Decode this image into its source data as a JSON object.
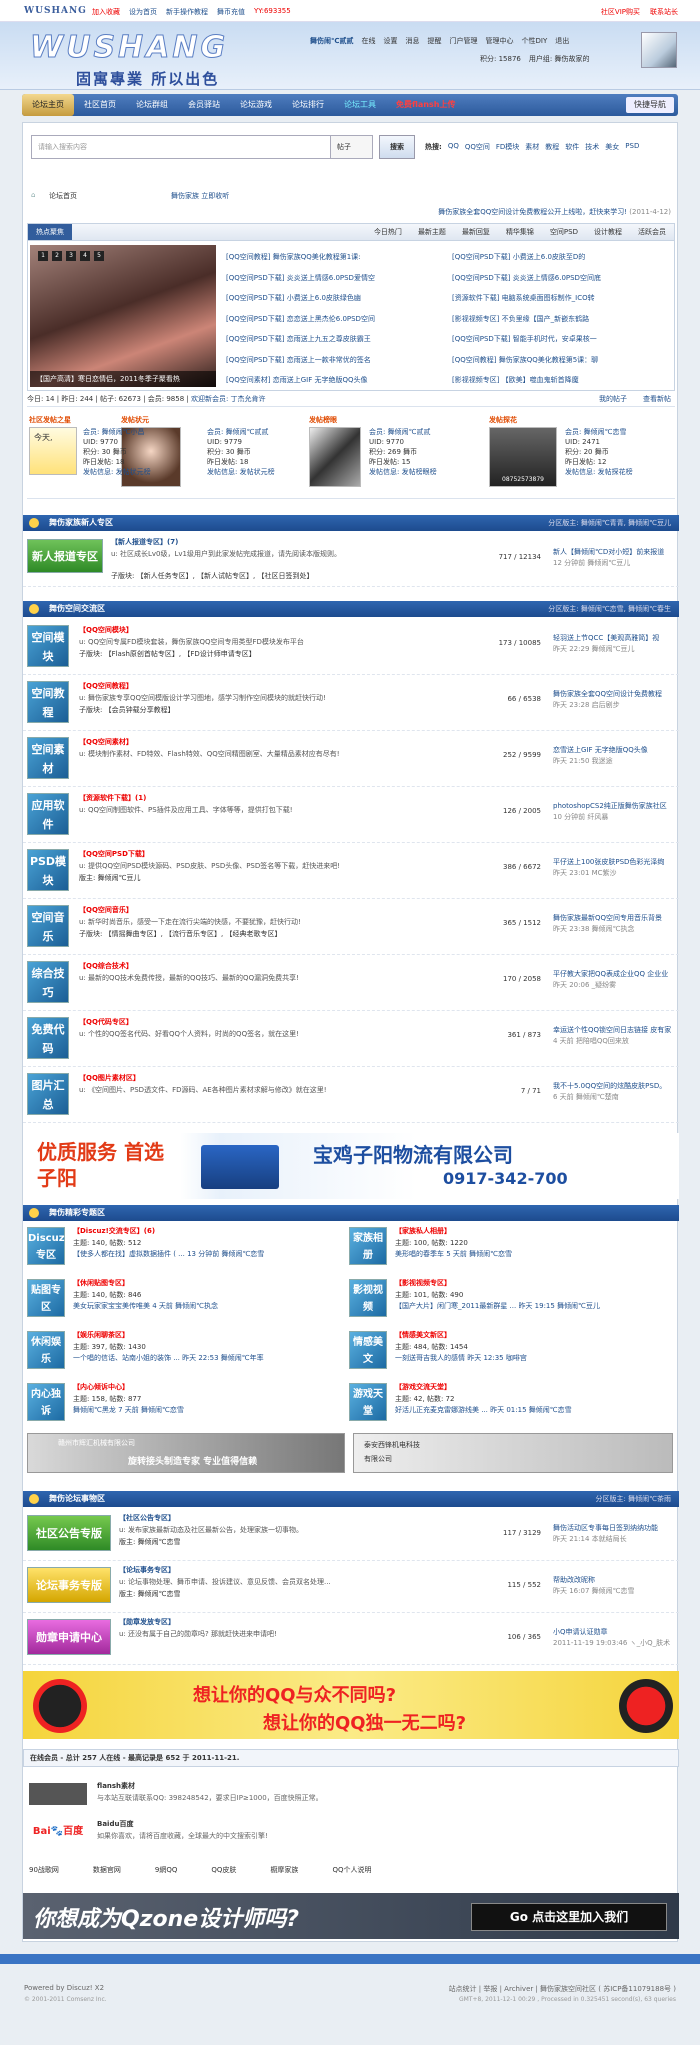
{
  "topbar": {
    "logo": "WUSHANG",
    "links": [
      "加入收藏",
      "设为首页",
      "新手操作教程",
      "舞币充值",
      "YY:693355"
    ],
    "right": [
      "社区VIP购买",
      "联系站长"
    ]
  },
  "header": {
    "logo": "WUSHANG",
    "slogan": "固寓專業 所以出色",
    "user": [
      "舞伤闹℃贰贰",
      "在线",
      "设置",
      "消息",
      "提醒",
      "门户管理",
      "管理中心",
      "个性DIY",
      "退出"
    ],
    "user2": [
      "积分: 15876",
      "用户组: 舞伤故家的"
    ]
  },
  "nav": {
    "items": [
      "论坛主页",
      "社区首页",
      "论坛群组",
      "会员驿站",
      "论坛游戏",
      "论坛排行",
      "论坛工具",
      "免费flansh上传"
    ],
    "quick": "快捷导航"
  },
  "search": {
    "placeholder": "请输入搜索内容",
    "select": "帖子",
    "button": "搜索",
    "hot_label": "热搜:",
    "hot": [
      "QQ",
      "QQ空间",
      "FD模块",
      "素材",
      "教程",
      "软件",
      "技术",
      "美女",
      "PSD"
    ]
  },
  "crumb": {
    "board": "论坛首页",
    "fav": "舞伤家族",
    "fav2": "立即收听"
  },
  "notice": {
    "text": "舞伤家族全套QQ空间设计免费教程公开上线啦，赶快来学习!",
    "date": "(2011-4-12)"
  },
  "tabs": {
    "items": [
      "热点聚焦",
      "今日热门",
      "最新主题",
      "最新回复",
      "精华集锦",
      "空间PSD",
      "设计教程",
      "活跃会员"
    ]
  },
  "feature": {
    "dots": [
      "1",
      "2",
      "3",
      "4",
      "5"
    ],
    "caption": "【国产高清】寒日恋情侣，2011冬季子聚看热",
    "col1": [
      "[QQ空间教程] 舞伤家族QQ美化教程第1课:",
      "[QQ空间PSD下载] 炎炎送上情感6.0PSD爱情空",
      "[QQ空间PSD下载] 小费送上6.0皮肤绿色幽",
      "[QQ空间PSD下载] 恋恋送上黑杰伦6.0PSD空间",
      "[QQ空间PSD下载] 恋雨送上九五之尊皮肤霸王",
      "[QQ空间PSD下载] 恋雨送上一款非常优的签名",
      "[QQ空间素材] 恋雨送上GIF 无字绝版QQ头像"
    ],
    "col2": [
      "[QQ空间PSD下载] 小费送上6.0皮肤至D的",
      "[QQ空间PSD下载] 炎炎送上情感6.0PSD空间底",
      "[资源软件下载] 电脑系统桌面图标制作_ICO转",
      "[影视视频专区] 不负里缘【国产_新嵌东鹤路",
      "[QQ空间PSD下载] 智能手机时代，安卓果核一",
      "[QQ空间教程] 舞伤家族QQ美化教程第5课：聊",
      "[影视视频专区] 【欧美】噬血鬼斩首降魔"
    ]
  },
  "stats": {
    "today": "今日: 14",
    "yesterday": "昨日: 244",
    "threads": "帖子: 62673",
    "members": "会员: 9858",
    "newest": "欢迎新会员: 丁杰允肯许",
    "mine": "我的帖子",
    "view": "查看新帖"
  },
  "stars": [
    {
      "title": "社区发帖之星",
      "name": "会员: 舞倾闹℃小昌",
      "uid": "UID: 9770",
      "credit": "积分: 30 舞币",
      "yday": "昨日发帖: 18",
      "link": "发帖信息: 发帖状元榜",
      "pic": "今天,"
    },
    {
      "title": "发帖状元",
      "name": "会员: 舞倾闹℃贰贰",
      "uid": "UID: 9779",
      "credit": "积分: 30 舞币",
      "yday": "昨日发帖: 18",
      "link": "发帖信息: 发帖状元榜",
      "pic": ""
    },
    {
      "title": "发帖榜眼",
      "name": "会员: 舞倾闹℃贰贰",
      "uid": "UID: 9770",
      "credit": "积分: 269 舞币",
      "yday": "昨日发帖: 15",
      "link": "发帖信息: 发帖榜眼榜",
      "pic": ""
    },
    {
      "title": "发帖探花",
      "name": "会员: 舞倾闹℃恋雪",
      "uid": "UID: 2471",
      "credit": "积分: 20 舞币",
      "yday": "昨日发帖: 12",
      "link": "发帖信息: 发帖探花榜",
      "pic": "08752573879"
    }
  ],
  "s1": {
    "title": "舞伤家族新人专区",
    "mod": "分区版主: 舞倾闹℃青青, 舞倾闹℃豆儿",
    "rows": [
      {
        "icon": "新人报道专区",
        "title": "【新人报道专区】(7)",
        "desc": "u: 社区成长Lv0级，Lv1级用户到此家发帖完成报道，请先阅读本版规则。",
        "sub": "子版块: 【新人任务专区】, 【新人试帖专区】, 【社区日签到处】",
        "num": "717 / 12134",
        "last": "新人【舞倾闹℃D对小短】前来报道",
        "last2": "12 分钟前 舞倾闹℃豆儿"
      }
    ]
  },
  "s2": {
    "title": "舞伤空间交流区",
    "mod": "分区版主: 舞倾闹℃恋雪, 舞倾闹℃春生",
    "rows": [
      {
        "icon": "空间模块",
        "title": "【QQ空间模块】",
        "desc": "u: QQ空间专属FD模块套装，舞伤家族QQ空间专用类型FD模块发布平台",
        "sub": "子版块: 【Flash原创首帖专区】, 【FD设计师申请专区】",
        "num": "173 / 10085",
        "last": "轻羽送上节QCC【美观高雅简】视",
        "last2": "昨天 22:29 舞倾闹℃豆儿"
      },
      {
        "icon": "空间教程",
        "title": "【QQ空间教程】",
        "desc": "u: 舞伤家族专享QQ空间模版设计学习图地，感学习制作空间模块的就赶快行动!",
        "sub": "子版块: 【会员钟载分享教程】",
        "num": "66 / 6538",
        "last": "舞伤家族全套QQ空间设计免费教程",
        "last2": "昨天 23:28 启后剧步"
      },
      {
        "icon": "空间素材",
        "title": "【QQ空间素材】",
        "desc": "u: 模块制作素材、FD特效、Flash特效、QQ空间精图剧室、大量精品素材应有尽有!",
        "sub": "",
        "num": "252 / 9599",
        "last": "恋雪送上GIF 无字绝版QQ头像",
        "last2": "昨天 21:50 我迷途"
      },
      {
        "icon": "应用软件",
        "title": "【资源软件下载】(1)",
        "desc": "u: QQ空间制图软件、PS插件及应用工具、字体等等，提供打包下载!",
        "sub": "",
        "num": "126 / 2005",
        "last": "photoshopCS2纯正版舞伤家族社区",
        "last2": "10 分钟前 纤风暴"
      },
      {
        "icon": "PSD模块",
        "title": "【QQ空间PSD下载】",
        "desc": "u: 提供QQ空间PSD模块源码、PSD皮肤、PSD头像、PSD签名等下载，赶快进来吧!",
        "sub": "版主: 舞倾闹℃豆儿",
        "num": "386 / 6672",
        "last": "平仔送上100张皮肤PSD色彩光泽绚",
        "last2": "昨天 23:01 MC紫沙"
      },
      {
        "icon": "空间音乐",
        "title": "【QQ空间音乐】",
        "desc": "u: 新华时尚音乐，感受一下走在流行尖端的快感，不要犹豫，赶快行动!",
        "sub": "子版块: 【情摇舞曲专区】, 【流行音乐专区】, 【经典老歌专区】",
        "num": "365 / 1512",
        "last": "舞伤家族最新QQ空间专用音乐背景",
        "last2": "昨天 23:38 舞倾闹℃执念"
      },
      {
        "icon": "综合技巧",
        "title": "【QQ综合技术】",
        "desc": "u: 最新的QQ技术免费传授，最新的QQ技巧、最新的QQ漏洞免费共享!",
        "sub": "",
        "num": "170 / 2058",
        "last": "平仔教大家把QQ表成企业QQ 企业业",
        "last2": "昨天 20:06 _疑纷雾"
      },
      {
        "icon": "免费代码",
        "title": "【QQ代码专区】",
        "desc": "u: 个性的QQ签名代码、好看QQ个人资料，时尚的QQ签名，就在这里!",
        "sub": "",
        "num": "361 / 873",
        "last": "幸运送个性QQ锁空间日志链接 皮有家",
        "last2": "4 天前 把陪唱QQ回来放"
      },
      {
        "icon": "图片汇总",
        "title": "【QQ图片素材区】",
        "desc": "u: 《空间图片、PSD透文件、FD源码、AE各种图片素材求解与修改》就在这里!",
        "sub": "",
        "num": "7 / 71",
        "last": "我不十5.0QQ空间的炫酷皮肤PSD。",
        "last2": "6 天前 舞倾闹℃楚南"
      }
    ]
  },
  "ad1": {
    "left": "优质服务 首选子阳",
    "right": "宝鸡子阳物流有限公司",
    "phone": "0917-342-700"
  },
  "s3": {
    "title": "舞伤精彩专题区",
    "items": [
      {
        "icon": "Discuz专区",
        "title": "【Discuz!交流专区】(6)",
        "l1": "主题: 140, 帖数: 512",
        "l2": "【使多人都在找】虚拟数据插件 ( ... 13 分钟前 舞倾闹℃恋雪"
      },
      {
        "icon": "家族相册",
        "title": "【家族私人相册】",
        "l1": "主题: 100, 帖数: 1220",
        "l2": "美形唱的春季车 5 天前 舞倾闹℃恋雪"
      },
      {
        "icon": "贴图专区",
        "title": "【休闲贴图专区】",
        "l1": "主题: 140, 帖数: 846",
        "l2": "美女玩家家宝宝美传唯美 4 天前 舞倾闹℃执念"
      },
      {
        "icon": "影视视频",
        "title": "【影视视频专区】",
        "l1": "主题: 101, 帖数: 490",
        "l2": "【国产大片】闲门寒_2011最新群星 ... 昨天 19:15 舞倾闹℃豆儿"
      },
      {
        "icon": "休闲娱乐",
        "title": "【娱乐闲聊茶区】",
        "l1": "主题: 397, 帖数: 1430",
        "l2": "一个唱的信话、站南小姐的装饰 ... 昨天 22:53 舞倾闹℃年率"
      },
      {
        "icon": "情感美文",
        "title": "【情感美文新区】",
        "l1": "主题: 484, 帖数: 1454",
        "l2": "一刻送哥吉我人的感情 昨天 12:35 咖啡宫"
      },
      {
        "icon": "内心独诉",
        "title": "【内心倾诉中心】",
        "l1": "主题: 158, 帖数: 877",
        "l2": "舞倾闹℃黑龙 7 天前 舞倾闹℃恋雪"
      },
      {
        "icon": "游戏天堂",
        "title": "【游戏交流天堂】",
        "l1": "主题: 42, 帖数: 72",
        "l2": "好活儿正充麦克雷娜游线美 ... 昨天 01:15 舞倾闹℃恋雪"
      }
    ]
  },
  "ad2": {
    "left1": "赣州市辉汇机械有限公司",
    "left2": "旋转接头制造专家 专业值得信赖",
    "right1": "泰安西锋机电科技",
    "right2": "有限公司"
  },
  "s4": {
    "title": "舞伤论坛事物区",
    "mod": "分区版主: 舞倾闹℃茶雨",
    "rows": [
      {
        "icon": "社区公告专版",
        "title": "【社区公告专区】",
        "desc": "u: 发布家族最新动态及社区最新公告，处理家族一切事物。",
        "sub": "版主: 舞倾闹℃恋雪",
        "num": "117 / 3129",
        "last": "舞伤活动区专事每日签到纳纳功能",
        "last2": "昨天 21:14 本就结局长"
      },
      {
        "icon": "论坛事务专版",
        "title": "【论坛事务专区】",
        "desc": "u: 论坛事物处理、舞币申请、投诉建议、意见反馈、会员双名处理...",
        "sub": "版主: 舞倾闹℃恋雪",
        "num": "115 / 552",
        "last": "帮助改改昵称",
        "last2": "昨天 16:07 舞倾闹℃恋雪"
      },
      {
        "icon": "勋章申请中心",
        "title": "【勋章发放专区】",
        "desc": "u: 还没有属于自己的勋章吗? 那就赶快进来申请吧!",
        "sub": "",
        "num": "106 / 365",
        "last": "小Q申请认证勋章",
        "last2": "2011-11-19 19:03:46 ヽ_小Q_肤术"
      }
    ]
  },
  "ad3": {
    "line1": "想让你的QQ与众不同吗?",
    "line2": "想让你的QQ独一无二吗?"
  },
  "online": {
    "head": "在线会员 - 总计 257 人在线 - 最高记录是 652 于 2011-11-21.",
    "links": [
      {
        "name": "flansh素材",
        "desc": "与本站互联请联系QQ: 398248542，要求日IP≥1000，百度快照正常。"
      },
      {
        "name": "Baidu百度",
        "desc": "如果你喜欢，请将百度收藏，全球最大的中文搜索引擎!"
      }
    ],
    "small": [
      "90战歌网",
      "数据官网",
      "9網QQ",
      "QQ皮肤",
      "橱摩家族",
      "QQ个人说明"
    ]
  },
  "ad4": {
    "text": "你想成为Qzone设计师吗?",
    "btn": "Go 点击这里加入我们"
  },
  "footer": {
    "powered": "Powered by Discuz! X2",
    "copy": "© 2001-2011 Comsenz Inc.",
    "links": "站点统计 | 举报 | Archiver | 舞伤家族空间社区 ( 苏ICP备11079188号 )",
    "time": "GMT+8, 2011-12-1 00:29 , Processed in 0.325451 second(s), 63 queries"
  }
}
